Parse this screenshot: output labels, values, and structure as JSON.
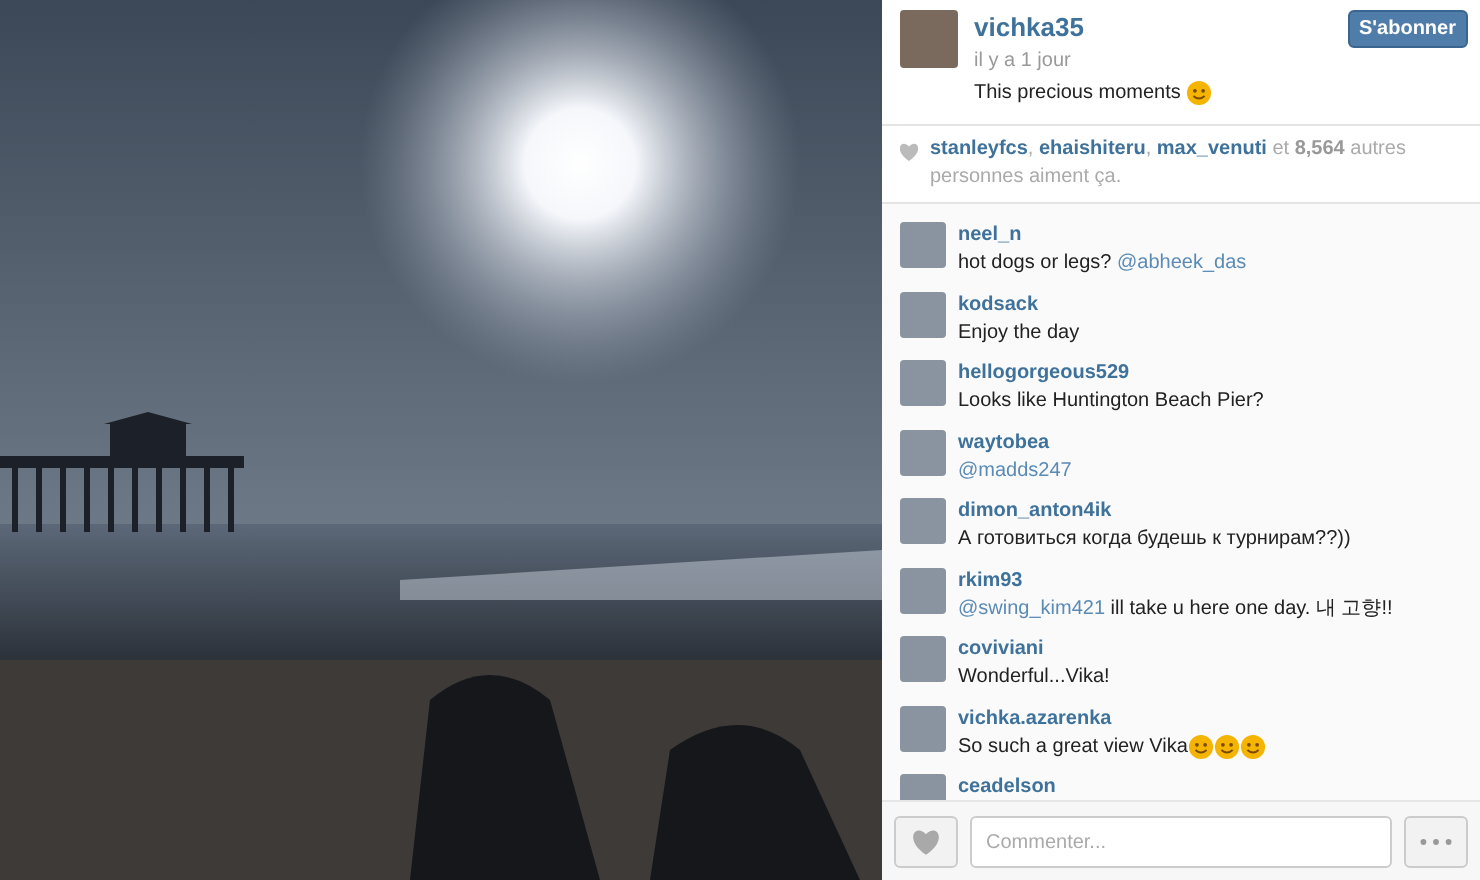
{
  "post": {
    "username": "vichka35",
    "time": "il y a 1 jour",
    "caption": [
      {
        "kind": "text",
        "text": "This precious moments"
      },
      {
        "kind": "emoji"
      }
    ],
    "follow_button": "S'abonner"
  },
  "likes": [
    {
      "kind": "user",
      "text": "stanleyfcs"
    },
    {
      "kind": "text",
      "text": ","
    },
    {
      "kind": "user",
      "text": "ehaishiteru"
    },
    {
      "kind": "text",
      "text": ","
    },
    {
      "kind": "user",
      "text": "max_venuti"
    },
    {
      "kind": "text",
      "text": "et"
    },
    {
      "kind": "count",
      "text": "8,564"
    },
    {
      "kind": "text",
      "text": "autres personnes aiment ça."
    }
  ],
  "comments": [
    {
      "user": "neel_n",
      "parts": [
        {
          "kind": "text",
          "text": "hot dogs or legs?"
        },
        {
          "kind": "mention",
          "text": "@abheek_das"
        }
      ]
    },
    {
      "user": "kodsack",
      "parts": [
        {
          "kind": "text",
          "text": "Enjoy the day"
        }
      ]
    },
    {
      "user": "hellogorgeous529",
      "parts": [
        {
          "kind": "text",
          "text": "Looks like Huntington Beach Pier?"
        }
      ]
    },
    {
      "user": "waytobea",
      "parts": [
        {
          "kind": "mention",
          "text": "@madds247"
        }
      ]
    },
    {
      "user": "dimon_anton4ik",
      "parts": [
        {
          "kind": "text",
          "text": "А готовиться когда будешь к турнирам??))"
        }
      ]
    },
    {
      "user": "rkim93",
      "parts": [
        {
          "kind": "mention",
          "text": "@swing_kim421"
        },
        {
          "kind": "text",
          "text": "ill take u here one day. 내 고향!!"
        }
      ]
    },
    {
      "user": "coviviani",
      "parts": [
        {
          "kind": "text",
          "text": "Wonderful...Vika!"
        }
      ]
    },
    {
      "user": "vichka.azarenka",
      "parts": [
        {
          "kind": "text",
          "text": "So such a great view Vika"
        },
        {
          "kind": "emoji"
        },
        {
          "kind": "emoji"
        },
        {
          "kind": "emoji"
        }
      ]
    },
    {
      "user": "ceadelson"
    }
  ],
  "comment_box": {
    "placeholder": "Commenter..."
  }
}
